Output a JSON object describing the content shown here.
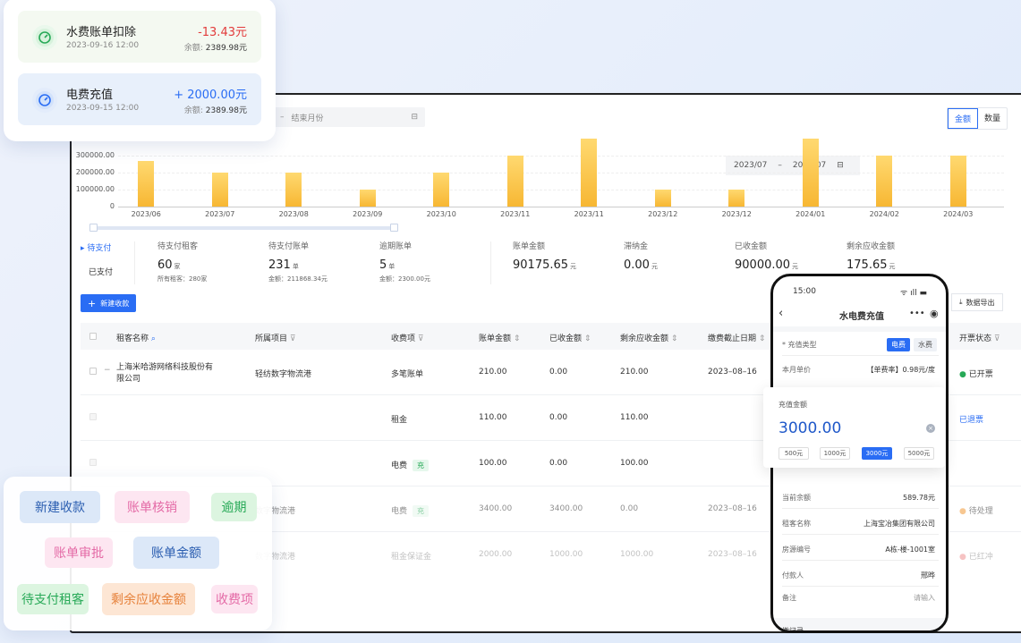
{
  "toolbar": {
    "range_sep": "–",
    "range_end": "结束月份",
    "toggle": [
      "金额",
      "数量"
    ]
  },
  "chart_data": {
    "type": "bar",
    "categories": [
      "2023/06",
      "2023/07",
      "2023/08",
      "2023/09",
      "2023/10",
      "2023/11",
      "2023/11",
      "2023/12",
      "2023/12",
      "2024/01",
      "2024/02",
      "2024/03"
    ],
    "values": [
      270000,
      200000,
      200000,
      100000,
      200000,
      300000,
      400000,
      100000,
      100000,
      400000,
      300000,
      300000
    ],
    "yticks": [
      "0",
      "100000.00",
      "200000.00",
      "300000.00"
    ],
    "ylim": [
      0,
      400000
    ],
    "colors": {
      "bar_top": "#ffd970",
      "bar_bottom": "#f7b733"
    },
    "date_range": {
      "start": "2023/07",
      "sep": "–",
      "end": "2023/07"
    }
  },
  "summary": {
    "tabs": [
      "待支付",
      "已支付"
    ],
    "stats": [
      {
        "label": "待支付租客",
        "value": "60",
        "unit": "家",
        "sub": "所有租客：280家"
      },
      {
        "label": "待支付账单",
        "value": "231",
        "unit": "单",
        "sub": "金额：211868.34元"
      },
      {
        "label": "逾期账单",
        "value": "5",
        "unit": "单",
        "sub": "金额：2300.00元"
      },
      {
        "label": "账单金额",
        "value": "90175.65",
        "unit": "元",
        "sub": ""
      },
      {
        "label": "滞纳金",
        "value": "0.00",
        "unit": "元",
        "sub": ""
      },
      {
        "label": "已收金额",
        "value": "90000.00",
        "unit": "元",
        "sub": ""
      },
      {
        "label": "剩余应收金额",
        "value": "175.65",
        "unit": "元",
        "sub": ""
      }
    ]
  },
  "actions": {
    "new": "新建收款",
    "export": "数据导出"
  },
  "table": {
    "headers": [
      "租客名称",
      "所属项目",
      "收费项",
      "账单金额",
      "已收金额",
      "剩余应收金额",
      "缴费截止日期",
      "开票状态"
    ],
    "rows": [
      {
        "name": "上海米哈游网络科技股份有限公司",
        "project": "轻纺数字物流港",
        "item": "多笔账单",
        "tag": "",
        "amount": "210.00",
        "received": "0.00",
        "remain": "210.00",
        "due": "2023–08–16",
        "invoice": "已开票"
      },
      {
        "name": "",
        "project": "",
        "item": "租金",
        "tag": "",
        "amount": "110.00",
        "received": "0.00",
        "remain": "110.00",
        "due": "",
        "invoice": "已退票"
      },
      {
        "name": "",
        "project": "",
        "item": "电费",
        "tag": "充",
        "amount": "100.00",
        "received": "0.00",
        "remain": "100.00",
        "due": "",
        "invoice": ""
      },
      {
        "name": "",
        "project": "数字物流港",
        "item": "电费",
        "tag": "充",
        "amount": "3400.00",
        "received": "3400.00",
        "remain": "0.00",
        "due": "2023–08–16",
        "invoice": "待处理"
      },
      {
        "name": "",
        "project": "数字物流港",
        "item": "租金保证金",
        "tag": "",
        "amount": "2000.00",
        "received": "1000.00",
        "remain": "1000.00",
        "due": "2023–08–16",
        "invoice": "已红冲"
      }
    ]
  },
  "transactions": [
    {
      "title": "水费账单扣除",
      "date": "2023-09-16 12:00",
      "amount": "-13.43元",
      "balance_label": "余额:",
      "balance": "2389.98元",
      "color": "#e23b3b"
    },
    {
      "title": "电费充值",
      "date": "2023-09-15 12:00",
      "amount": "+ 2000.00元",
      "balance_label": "余额:",
      "balance": "2389.98元",
      "color": "#2a6df4"
    }
  ],
  "chips": [
    "新建收款",
    "账单核销",
    "逾期",
    "账单审批",
    "账单金额",
    "待支付租客",
    "剩余应收金额",
    "收费项"
  ],
  "phone": {
    "time": "15:00",
    "title": "水电费充值",
    "type_label": "* 充值类型",
    "types": [
      "电费",
      "水费"
    ],
    "price_label": "本月单价",
    "price_value": "【单费率】0.98元/度",
    "recharge_label": "充值金额",
    "recharge_value": "3000.00",
    "presets": [
      "500元",
      "1000元",
      "3000元",
      "5000元"
    ],
    "fields": [
      {
        "label": "当前余额",
        "value": "589.78元"
      },
      {
        "label": "租客名称",
        "value": "上海宝冶集团有限公司"
      },
      {
        "label": "房源编号",
        "value": "A栋-楼-1001室"
      },
      {
        "label": "付款人",
        "value": "邢晔"
      },
      {
        "label": "备注",
        "value": "请输入"
      }
    ],
    "footer": "缴记录"
  }
}
